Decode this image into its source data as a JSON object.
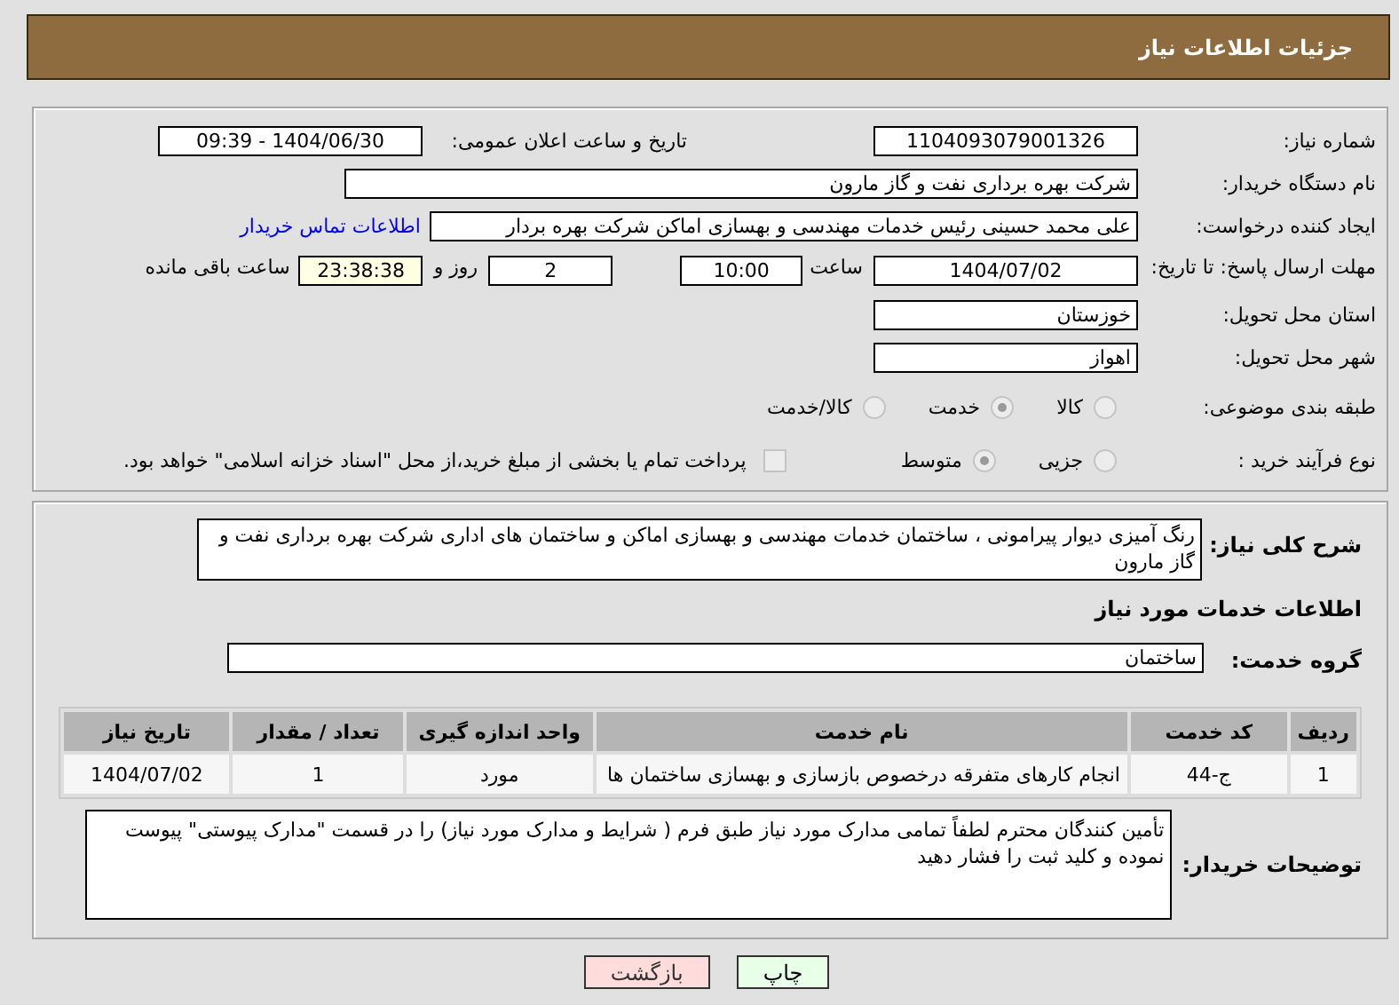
{
  "title": "جزئیات اطلاعات نیاز",
  "need_number": {
    "label": "شماره نیاز:",
    "value": "1104093079001326"
  },
  "announce_datetime": {
    "label": "تاریخ و ساعت اعلان عمومی:",
    "value": "1404/06/30 - 09:39"
  },
  "buyer_org": {
    "label": "نام دستگاه خریدار:",
    "value": "شرکت بهره برداری نفت و گاز مارون"
  },
  "requester": {
    "label": "ایجاد کننده درخواست:",
    "value": "علی محمد حسینی رئیس خدمات مهندسی و بهسازی اماکن شرکت بهره بردار",
    "link": "اطلاعات تماس خریدار"
  },
  "deadline": {
    "label": "مهلت ارسال پاسخ: تا تاریخ:",
    "date": "1404/07/02",
    "time_label": "ساعت",
    "time": "10:00",
    "days": "2",
    "days_label": "روز و",
    "remaining": "23:38:38",
    "remaining_label": "ساعت باقی مانده"
  },
  "province": {
    "label": "استان محل تحویل:",
    "value": "خوزستان"
  },
  "city": {
    "label": "شهر محل تحویل:",
    "value": "اهواز"
  },
  "category": {
    "label": "طبقه بندی موضوعی:",
    "options": [
      {
        "label": "کالا",
        "selected": false
      },
      {
        "label": "خدمت",
        "selected": true
      },
      {
        "label": "کالا/خدمت",
        "selected": false
      }
    ]
  },
  "process": {
    "label": "نوع فرآیند خرید :",
    "options": [
      {
        "label": "جزیی",
        "selected": false
      },
      {
        "label": "متوسط",
        "selected": true
      }
    ],
    "payment": {
      "label": "پرداخت تمام یا بخشی از مبلغ خرید،از محل \"اسناد خزانه اسلامی\" خواهد بود.",
      "checked": false
    }
  },
  "summary": {
    "label": "شرح کلی نیاز:",
    "value": "رنگ آمیزی دیوار پیرامونی ، ساختمان خدمات مهندسی و بهسازی اماکن و ساختمان های اداری شرکت بهره برداری نفت و گاز مارون"
  },
  "services_heading": "اطلاعات خدمات مورد نیاز",
  "service_group": {
    "label": "گروه خدمت:",
    "value": "ساختمان"
  },
  "table": {
    "columns": [
      "ردیف",
      "کد خدمت",
      "نام خدمت",
      "واحد اندازه گیری",
      "تعداد / مقدار",
      "تاریخ نیاز"
    ],
    "rows": [
      [
        "1",
        "ج-44",
        "انجام کارهای متفرقه درخصوص بازسازی و بهسازی ساختمان ها",
        "مورد",
        "1",
        "1404/07/02"
      ]
    ]
  },
  "buyer_notes": {
    "label": "توضیحات خریدار:",
    "value": "تأمین کنندگان محترم لطفاً تمامی مدارک مورد نیاز طبق فرم ( شرایط و مدارک مورد نیاز) را در قسمت \"مدارک پیوستی\" پیوست نموده و کلید ثبت را فشار دهید"
  },
  "buttons": [
    {
      "label": "چاپ",
      "kind": "print"
    },
    {
      "label": "بازگشت",
      "kind": "back"
    }
  ]
}
